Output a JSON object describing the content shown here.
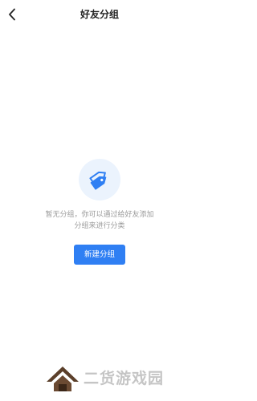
{
  "header": {
    "title": "好友分组",
    "back_icon": "chevron-left-icon"
  },
  "empty_state": {
    "icon": "tags-icon",
    "message": "暂无分组，你可以通过给好友添加分组来进行分类",
    "button_label": "新建分组"
  },
  "watermark": {
    "text": "二货游戏园",
    "logo_icon": "house-logo-icon"
  },
  "colors": {
    "accent": "#2f7ff3",
    "icon_background": "#ebf3fd",
    "title_text": "#222222",
    "hint_text": "#9a9a9a",
    "page_background": "#ffffff"
  }
}
